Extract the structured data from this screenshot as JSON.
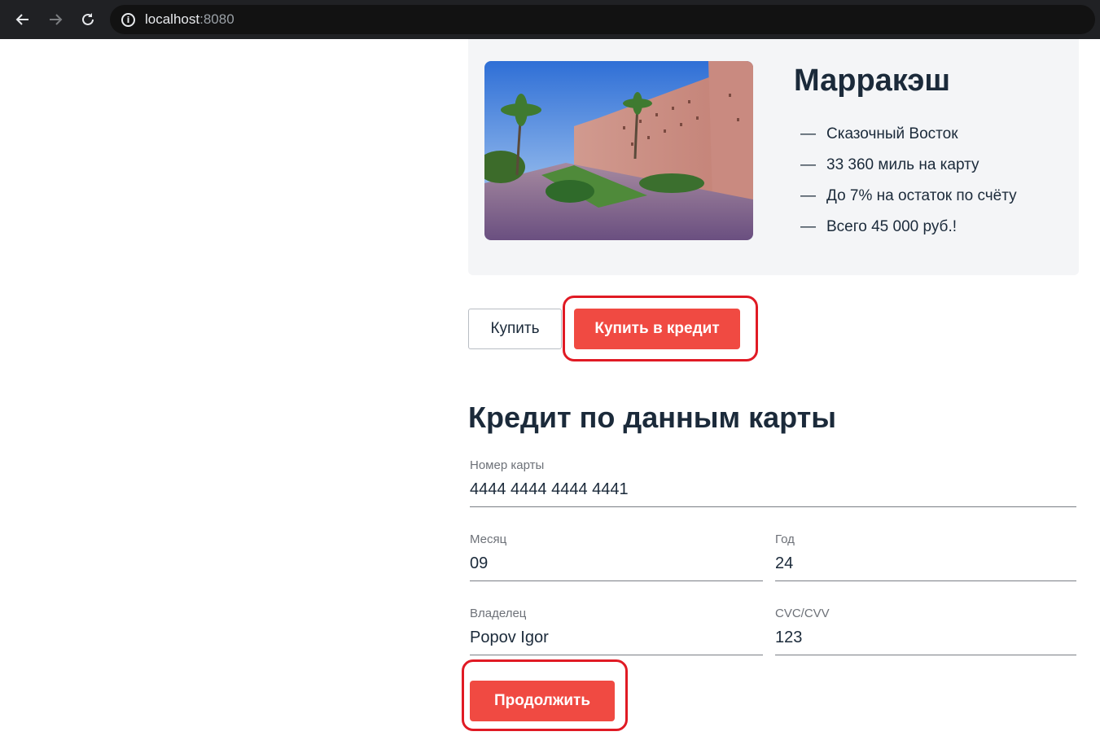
{
  "browser": {
    "url_host": "localhost",
    "url_port": ":8080"
  },
  "card": {
    "title": "Марракэш",
    "features": [
      "Сказочный Восток",
      "33 360 миль на карту",
      "До 7% на остаток по счёту",
      "Всего 45 000 руб.!"
    ],
    "dash": "—"
  },
  "actions": {
    "buy_label": "Купить",
    "buy_credit_label": "Купить в кредит"
  },
  "form": {
    "title": "Кредит по данным карты",
    "card_number": {
      "label": "Номер карты",
      "value": "4444 4444 4444 4441"
    },
    "month": {
      "label": "Месяц",
      "value": "09"
    },
    "year": {
      "label": "Год",
      "value": "24"
    },
    "owner": {
      "label": "Владелец",
      "value": "Popov Igor"
    },
    "cvc": {
      "label": "CVC/CVV",
      "value": "123"
    },
    "continue_label": "Продолжить"
  },
  "colors": {
    "accent": "#f04a42",
    "highlight": "#e01a24"
  }
}
